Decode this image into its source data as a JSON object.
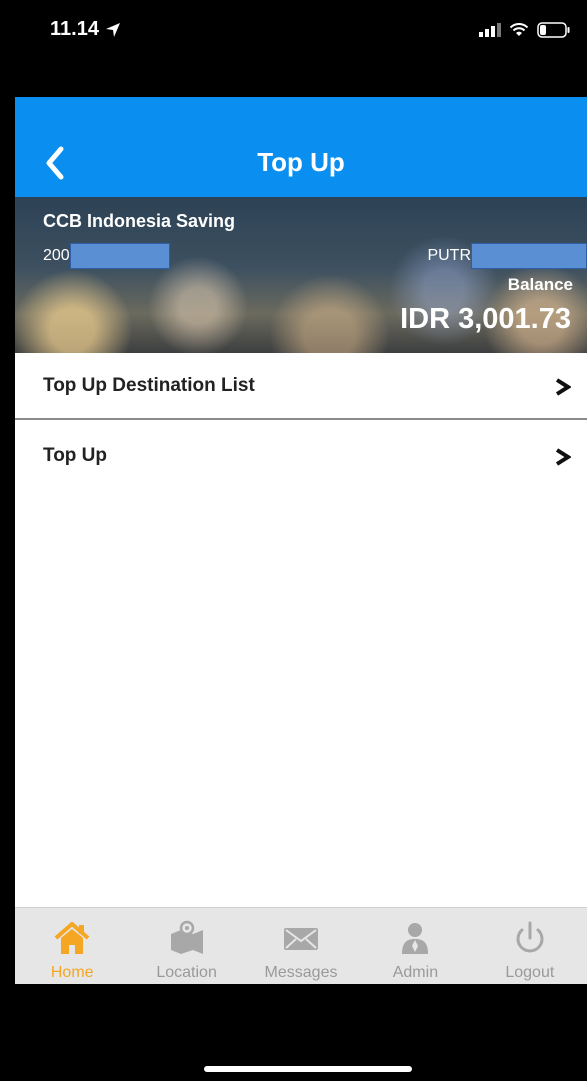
{
  "status_bar": {
    "time": "11.14"
  },
  "header": {
    "title": "Top Up"
  },
  "account": {
    "name": "CCB Indonesia Saving",
    "number_prefix": "200",
    "holder_prefix": "PUTR",
    "balance_label": "Balance",
    "balance_value": "IDR 3,001.73"
  },
  "menu": {
    "items": [
      {
        "label": "Top Up Destination List"
      },
      {
        "label": "Top Up"
      }
    ]
  },
  "tabbar": {
    "active_color": "#f5a623",
    "items": [
      {
        "label": "Home",
        "icon": "home-icon"
      },
      {
        "label": "Location",
        "icon": "map-icon"
      },
      {
        "label": "Messages",
        "icon": "envelope-icon"
      },
      {
        "label": "Admin",
        "icon": "user-icon"
      },
      {
        "label": "Logout",
        "icon": "power-icon"
      }
    ]
  }
}
